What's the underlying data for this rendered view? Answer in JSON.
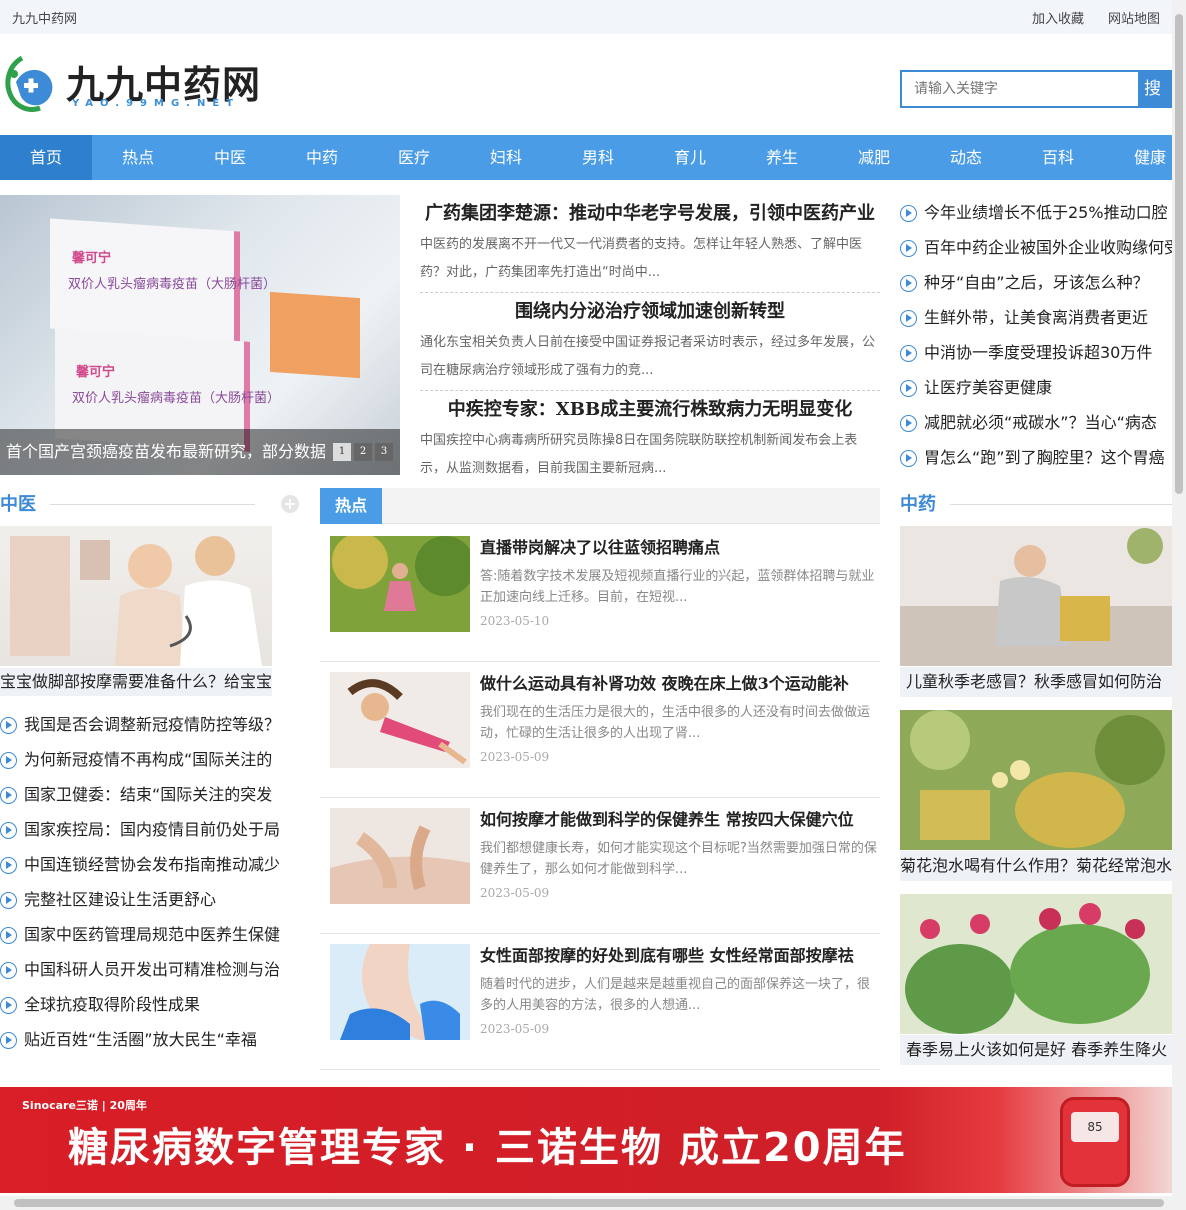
{
  "topbar": {
    "site_name": "九九中药网",
    "links": [
      "加入收藏",
      "网站地图"
    ]
  },
  "logo": {
    "name": "九九中药网",
    "domain": "YAO.99MG.NET"
  },
  "search": {
    "placeholder": "请输入关键字",
    "button": "搜索"
  },
  "nav": [
    "首页",
    "热点",
    "中医",
    "中药",
    "医疗",
    "妇科",
    "男科",
    "育儿",
    "养生",
    "减肥",
    "动态",
    "百科",
    "健康"
  ],
  "slider": {
    "caption": "首个国产宫颈癌疫苗发布最新研究，部分数据",
    "pages": [
      "1",
      "2",
      "3"
    ],
    "product_brand": "馨可宁",
    "product_name": "双价人乳头瘤病毒疫苗（大肠杆菌）"
  },
  "headlines": [
    {
      "title": "广药集团李楚源：推动中华老字号发展，引领中医药产业",
      "desc": "中医药的发展离不开一代又一代消费者的支持。怎样让年轻人熟悉、了解中医药？对此，广药集团率先打造出“时尚中..."
    },
    {
      "title": "围绕内分泌治疗领域加速创新转型",
      "desc": "通化东宝相关负责人日前在接受中国证券报记者采访时表示，经过多年发展，公司在糖尿病治疗领域形成了强有力的竞..."
    },
    {
      "title": "中疾控专家：XBB成主要流行株致病力无明显变化",
      "desc": "中国疾控中心病毒病所研究员陈操8日在国务院联防联控机制新闻发布会上表示，从监测数据看，目前我国主要新冠病..."
    }
  ],
  "right_top_list": [
    "今年业绩增长不低于25%推动口腔",
    "百年中药企业被国外企业收购缘何受",
    "种牙“自由”之后，牙该怎么种？",
    "生鲜外带，让美食离消费者更近",
    "中消协一季度受理投诉超30万件",
    "让医疗美容更健康",
    "减肥就必须“戒碳水”？当心“病态",
    "胃怎么“跑”到了胸腔里？这个胃癌"
  ],
  "left_section": {
    "title": "中医",
    "caption": "宝宝做脚部按摩需要准备什么？给宝宝",
    "list": [
      "我国是否会调整新冠疫情防控等级？",
      "为何新冠疫情不再构成“国际关注的",
      "国家卫健委：结束“国际关注的突发",
      "国家疾控局：国内疫情目前仍处于局",
      "中国连锁经营协会发布指南推动减少",
      "完整社区建设让生活更舒心",
      "国家中医药管理局规范中医养生保健",
      "中国科研人员开发出可精准检测与治",
      "全球抗疫取得阶段性成果",
      "贴近百姓“生活圈”放大民生“幸福"
    ]
  },
  "hot_section": {
    "tab": "热点",
    "articles": [
      {
        "title": "直播带岗解决了以往蓝领招聘痛点",
        "desc": "答:随着数字技术发展及短视频直播行业的兴起，蓝领群体招聘与就业正加速向线上迁移。目前，在短视...",
        "date": "2023-05-10"
      },
      {
        "title": "做什么运动具有补肾功效 夜晚在床上做3个运动能补",
        "desc": "我们现在的生活压力是很大的，生活中很多的人还没有时间去做做运动，忙碌的生活让很多的人出现了肾...",
        "date": "2023-05-09"
      },
      {
        "title": "如何按摩才能做到科学的保健养生 常按四大保健穴位",
        "desc": "我们都想健康长寿，如何才能实现这个目标呢?当然需要加强日常的保健养生了，那么如何才能做到科学...",
        "date": "2023-05-09"
      },
      {
        "title": "女性面部按摩的好处到底有哪些 女性经常面部按摩祛",
        "desc": "随着时代的进步，人们是越来是越重视自己的面部保养这一块了，很多的人用美容的方法，很多的人想通...",
        "date": "2023-05-09"
      }
    ]
  },
  "right_section": {
    "title": "中药",
    "captions": [
      "儿童秋季老感冒？秋季感冒如何防治",
      "菊花泡水喝有什么作用？菊花经常泡水",
      "春季易上火该如何是好 春季养生降火"
    ]
  },
  "banner": {
    "brand": "Sinocare三诺 | 20周年",
    "headline": "糖尿病数字管理专家 · 三诺生物 成立20周年",
    "meter_reading": "85"
  }
}
